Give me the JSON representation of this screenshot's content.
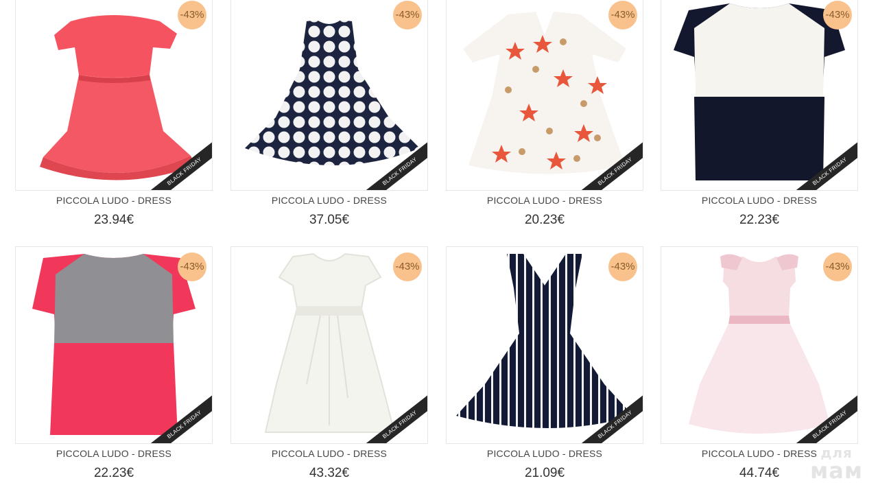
{
  "products": [
    {
      "name": "PICCOLA LUDO - DRESS",
      "price": "23.94€",
      "discount": "-43%",
      "ribbon": "BLACK FRIDAY",
      "image": "coral-ruffle-dress"
    },
    {
      "name": "PICCOLA LUDO - DRESS",
      "price": "37.05€",
      "discount": "-43%",
      "ribbon": "BLACK FRIDAY",
      "image": "navy-polka-dot-dress"
    },
    {
      "name": "PICCOLA LUDO - DRESS",
      "price": "20.23€",
      "discount": "-43%",
      "ribbon": "BLACK FRIDAY",
      "image": "starfish-print-dress"
    },
    {
      "name": "PICCOLA LUDO - DRESS",
      "price": "22.23€",
      "discount": "-43%",
      "ribbon": "BLACK FRIDAY",
      "image": "navy-white-colorblock-dress"
    },
    {
      "name": "PICCOLA LUDO - DRESS",
      "price": "22.23€",
      "discount": "-43%",
      "ribbon": "BLACK FRIDAY",
      "image": "pink-grey-colorblock-dress"
    },
    {
      "name": "PICCOLA LUDO - DRESS",
      "price": "43.32€",
      "discount": "-43%",
      "ribbon": "BLACK FRIDAY",
      "image": "white-bow-dress"
    },
    {
      "name": "PICCOLA LUDO - DRESS",
      "price": "21.09€",
      "discount": "-43%",
      "ribbon": "BLACK FRIDAY",
      "image": "navy-stripe-dress"
    },
    {
      "name": "PICCOLA LUDO - DRESS",
      "price": "44.74€",
      "discount": "-43%",
      "ribbon": "BLACK FRIDAY",
      "image": "pale-pink-tulle-dress"
    }
  ],
  "watermark": {
    "line1": "для",
    "line2": "мам"
  },
  "colors": {
    "badge": "#f9c28d",
    "ribbon": "#262626"
  }
}
